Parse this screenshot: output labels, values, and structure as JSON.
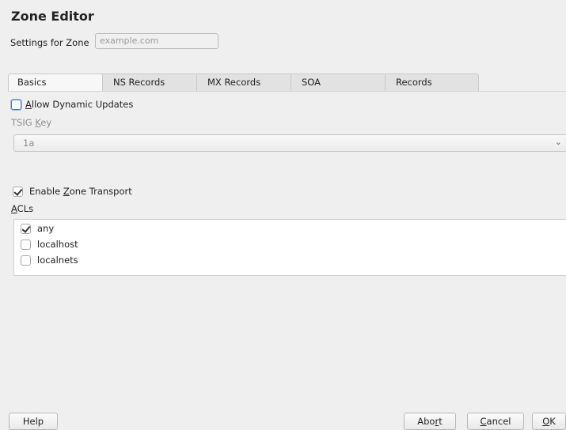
{
  "window": {
    "title": "Zone Editor"
  },
  "settings": {
    "label": "Settings for Zone",
    "zone_value": "example.com"
  },
  "tabs": [
    {
      "label": "Basics",
      "active": true
    },
    {
      "label": "NS Records",
      "active": false
    },
    {
      "label": "MX Records",
      "active": false
    },
    {
      "label": "SOA",
      "active": false
    },
    {
      "label": "Records",
      "active": false
    }
  ],
  "basics": {
    "allow_dynamic": {
      "mnemonic": "A",
      "rest": "llow Dynamic Updates",
      "checked": false
    },
    "tsig_key": {
      "prefix": "TSIG ",
      "mnemonic": "K",
      "rest": "ey",
      "value": "1a"
    },
    "enable_transport": {
      "prefix": "Enable ",
      "mnemonic": "Z",
      "rest": "one Transport",
      "checked": true
    },
    "acls": {
      "mnemonic": "A",
      "rest": "CLs",
      "items": [
        {
          "label": "any",
          "checked": true
        },
        {
          "label": "localhost",
          "checked": false
        },
        {
          "label": "localnets",
          "checked": false
        }
      ]
    }
  },
  "buttons": {
    "help": "Help",
    "abort": {
      "prefix": "Abo",
      "mnemonic": "r",
      "rest": "t"
    },
    "cancel": {
      "mnemonic": "C",
      "rest": "ancel"
    },
    "ok": {
      "mnemonic": "O",
      "rest": "K"
    }
  },
  "icons": {
    "dropdown": "chevron-down-icon",
    "check": "checkmark-icon"
  },
  "colors": {
    "background": "#efefef",
    "focus": "#4a7ab5"
  }
}
